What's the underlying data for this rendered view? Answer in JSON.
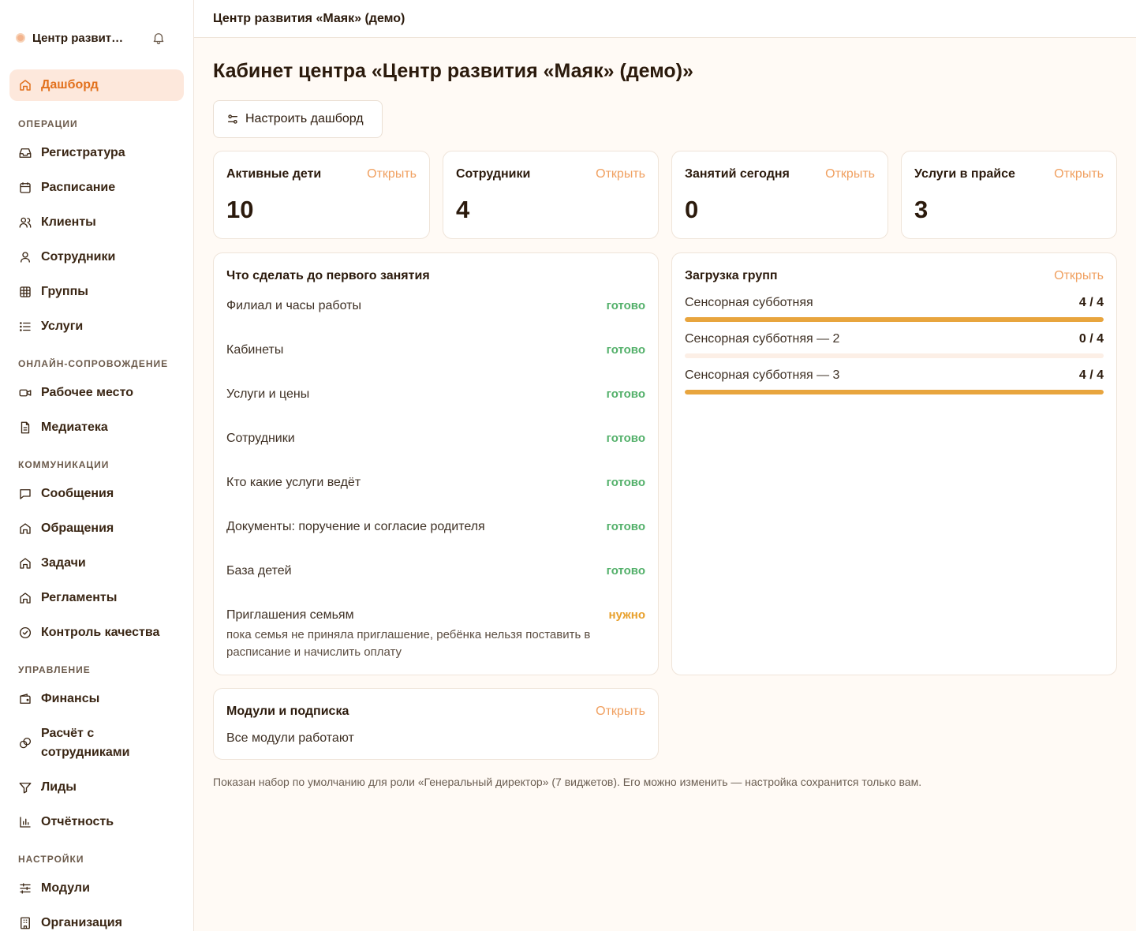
{
  "sidebar": {
    "brand": "Центр развит…",
    "items": {
      "dashboard": "Дашборд",
      "reception": "Регистратура",
      "schedule": "Расписание",
      "clients": "Клиенты",
      "staff": "Сотрудники",
      "groups": "Группы",
      "services": "Услуги",
      "workplace": "Рабочее место",
      "media": "Медиатека",
      "messages": "Сообщения",
      "appeals": "Обращения",
      "tasks": "Задачи",
      "regulations": "Регламенты",
      "quality": "Контроль качества",
      "finance": "Финансы",
      "payroll": "Расчёт с сотрудниками",
      "leads": "Лиды",
      "reports": "Отчётность",
      "modules": "Модули",
      "organization": "Организация"
    },
    "sections": {
      "operations": "ОПЕРАЦИИ",
      "online": "ОНЛАЙН-СОПРОВОЖДЕНИЕ",
      "communications": "КОММУНИКАЦИИ",
      "management": "УПРАВЛЕНИЕ",
      "settings": "НАСТРОЙКИ"
    }
  },
  "topbar": {
    "title": "Центр развития «Маяк» (демо)"
  },
  "page": {
    "title": "Кабинет центра «Центр развития «Маяк» (демо)»",
    "customize_label": "Настроить дашборд",
    "open_label": "Открыть",
    "footnote": "Показан набор по умолчанию для роли «Генеральный директор» (7 виджетов). Его можно изменить — настройка сохранится только вам."
  },
  "stats": [
    {
      "title": "Активные дети",
      "value": "10"
    },
    {
      "title": "Сотрудники",
      "value": "4"
    },
    {
      "title": "Занятий сегодня",
      "value": "0"
    },
    {
      "title": "Услуги в прайсе",
      "value": "3"
    }
  ],
  "todo": {
    "title": "Что сделать до первого занятия",
    "items": [
      {
        "label": "Филиал и часы работы",
        "status": "готово"
      },
      {
        "label": "Кабинеты",
        "status": "готово"
      },
      {
        "label": "Услуги и цены",
        "status": "готово"
      },
      {
        "label": "Сотрудники",
        "status": "готово"
      },
      {
        "label": "Кто какие услуги ведёт",
        "status": "готово"
      },
      {
        "label": "Документы: поручение и согласие родителя",
        "status": "готово"
      },
      {
        "label": "База детей",
        "status": "готово"
      },
      {
        "label": "Приглашения семьям",
        "status": "нужно",
        "hint": "пока семья не приняла приглашение, ребёнка нельзя поставить в расписание и начислить оплату"
      }
    ]
  },
  "groups": {
    "title": "Загрузка групп",
    "items": [
      {
        "name": "Сенсорная субботняя",
        "count": "4 / 4",
        "fill": 1.0
      },
      {
        "name": "Сенсорная субботняя — 2",
        "count": "0 / 4",
        "fill": 0.0
      },
      {
        "name": "Сенсорная субботняя — 3",
        "count": "4 / 4",
        "fill": 1.0
      }
    ]
  },
  "modules": {
    "title": "Модули и подписка",
    "text": "Все модули работают"
  },
  "colors": {
    "accent": "#e2711d",
    "open_link": "#f0a060",
    "done": "#53b06a",
    "need": "#e8a02b",
    "bar": "#e8a53e"
  }
}
